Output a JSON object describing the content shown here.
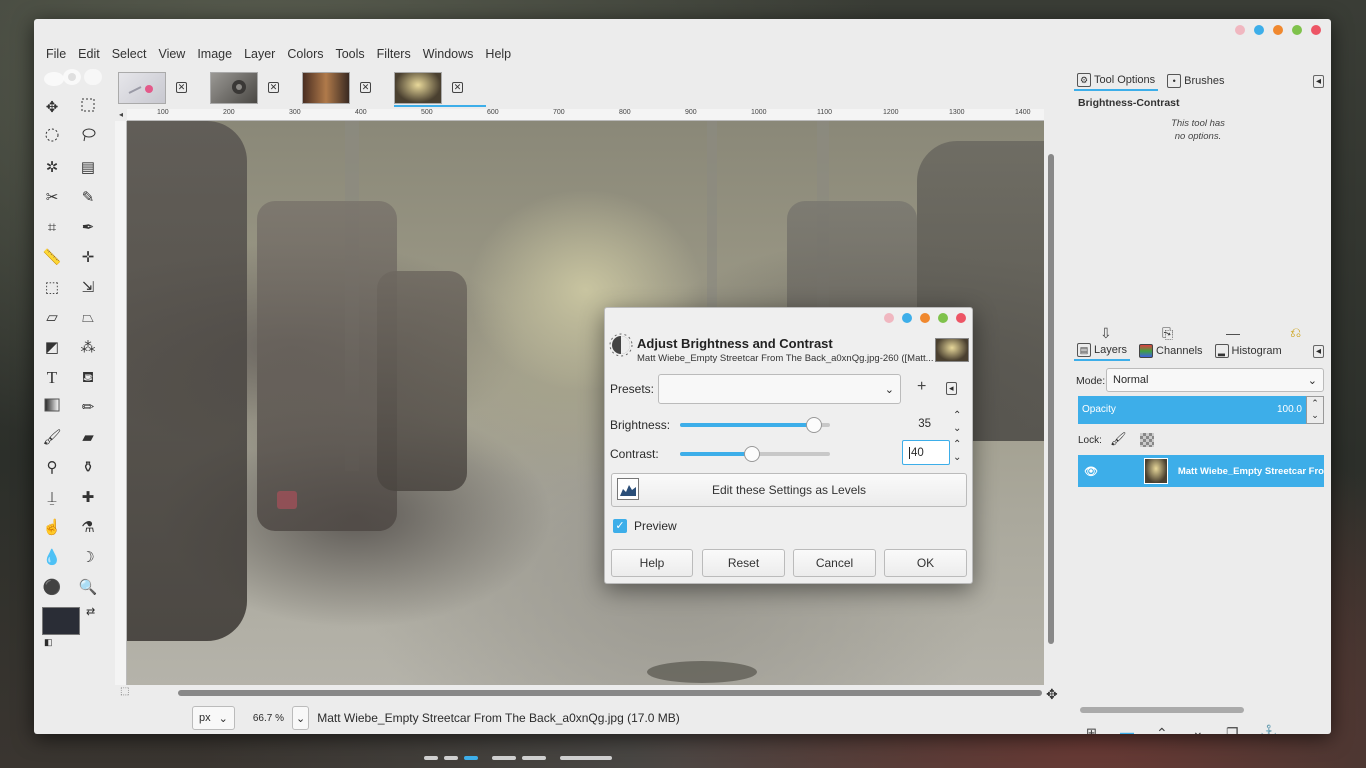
{
  "window": {
    "dots": [
      "#f0b7c0",
      "#3daee9",
      "#f0882e",
      "#7fc24b",
      "#ed5565"
    ]
  },
  "menubar": [
    "File",
    "Edit",
    "Select",
    "View",
    "Image",
    "Layer",
    "Colors",
    "Tools",
    "Filters",
    "Windows",
    "Help"
  ],
  "tabs": [
    {
      "thumb_color": "#d9d9de",
      "close": "✕"
    },
    {
      "thumb_color": "#6d6a66",
      "close": "✕"
    },
    {
      "thumb_color": "#7a4a30",
      "close": "✕"
    },
    {
      "thumb_color": "#6b5e3a",
      "close": "✕",
      "active": true
    }
  ],
  "ruler": {
    "h_labels": [
      "100",
      "200",
      "300",
      "400",
      "500",
      "600",
      "700",
      "800",
      "900",
      "1000",
      "1100",
      "1200",
      "1300",
      "1400"
    ]
  },
  "colors": {
    "fg": "#2a2d36",
    "bg": "#e8ebef",
    "accent": "#3daee9"
  },
  "statusbar": {
    "unit": "px",
    "zoom": "66.7 %",
    "filename": "Matt Wiebe_Empty Streetcar From The Back_a0xnQg.jpg (17.0 MB)"
  },
  "dock": {
    "tab_tool_options": "Tool Options",
    "tab_brushes": "Brushes",
    "tool_name": "Brightness-Contrast",
    "no_options_line1": "This tool has",
    "no_options_line2": "no options.",
    "tab_layers": "Layers",
    "tab_channels": "Channels",
    "tab_histogram": "Histogram",
    "mode_label": "Mode:",
    "mode_value": "Normal",
    "opacity_label": "Opacity",
    "opacity_value": "100.0",
    "lock_label": "Lock:",
    "layer_name": "Matt Wiebe_Empty Streetcar Fro"
  },
  "dialog": {
    "dots": [
      "#f0b7c0",
      "#3daee9",
      "#f0882e",
      "#7fc24b",
      "#ed5565"
    ],
    "title": "Adjust Brightness and Contrast",
    "subtitle": "Matt Wiebe_Empty Streetcar From The Back_a0xnQg.jpg-260 ([Matt...",
    "presets_label": "Presets:",
    "presets_value": "",
    "brightness_label": "Brightness:",
    "brightness_value": "35",
    "brightness_level": 0.89,
    "contrast_label": "Contrast:",
    "contrast_value": "40",
    "contrast_level": 0.48,
    "levels_button": "Edit these Settings as Levels",
    "preview_label": "Preview",
    "preview_checked": true,
    "help": "Help",
    "reset": "Reset",
    "cancel": "Cancel",
    "ok": "OK"
  }
}
